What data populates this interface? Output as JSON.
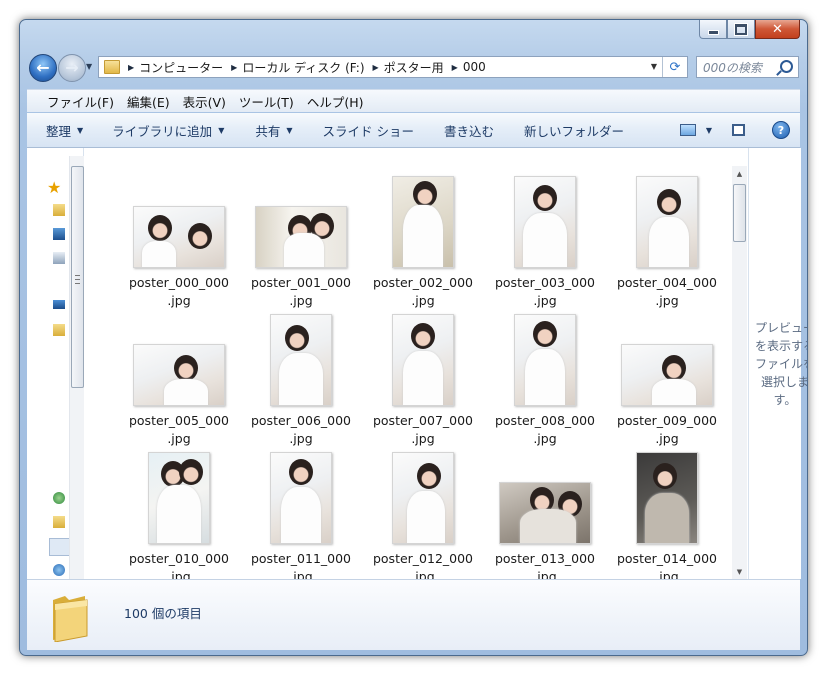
{
  "window": {
    "caption_buttons": [
      "minimize-icon",
      "maximize-icon",
      "close-icon"
    ]
  },
  "nav": {
    "breadcrumbs": [
      "コンピューター",
      "ローカル ディスク (F:)",
      "ポスター用",
      "000"
    ],
    "search_placeholder": "000の検索"
  },
  "menu": [
    "ファイル(F)",
    "編集(E)",
    "表示(V)",
    "ツール(T)",
    "ヘルプ(H)"
  ],
  "toolbar": {
    "organize": "整理",
    "add_to_library": "ライブラリに追加",
    "share": "共有",
    "slideshow": "スライド ショー",
    "burn": "書き込む",
    "new_folder": "新しいフォルダー"
  },
  "files": [
    {
      "name": "poster_000_000",
      "ext": ".jpg"
    },
    {
      "name": "poster_001_000",
      "ext": ".jpg"
    },
    {
      "name": "poster_002_000",
      "ext": ".jpg"
    },
    {
      "name": "poster_003_000",
      "ext": ".jpg"
    },
    {
      "name": "poster_004_000",
      "ext": ".jpg"
    },
    {
      "name": "poster_005_000",
      "ext": ".jpg"
    },
    {
      "name": "poster_006_000",
      "ext": ".jpg"
    },
    {
      "name": "poster_007_000",
      "ext": ".jpg"
    },
    {
      "name": "poster_008_000",
      "ext": ".jpg"
    },
    {
      "name": "poster_009_000",
      "ext": ".jpg"
    },
    {
      "name": "poster_010_000",
      "ext": ".jpg"
    },
    {
      "name": "poster_011_000",
      "ext": ".jpg"
    },
    {
      "name": "poster_012_000",
      "ext": ".jpg"
    },
    {
      "name": "poster_013_000",
      "ext": ".jpg"
    },
    {
      "name": "poster_014_000",
      "ext": ".jpg"
    }
  ],
  "preview_pane_text": "プレビューを表示するファイルを選択します。",
  "status": {
    "item_count": "100 個の項目"
  },
  "colors": {
    "frame": "#a9c4e4",
    "close": "#c2401e",
    "toolbar_text": "#1e3b66"
  }
}
